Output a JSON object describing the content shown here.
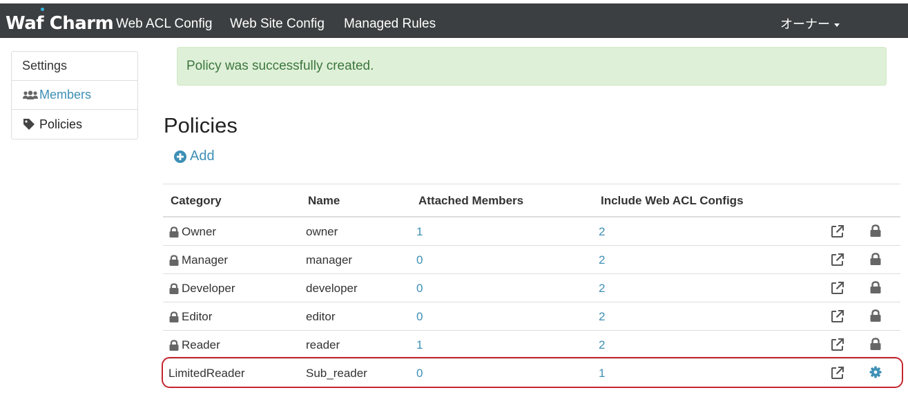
{
  "navbar": {
    "logo": "Waf Charm",
    "links": [
      "Web ACL Config",
      "Web Site Config",
      "Managed Rules"
    ],
    "user_menu": "オーナー"
  },
  "sidebar": {
    "heading": "Settings",
    "items": [
      {
        "label": "Members",
        "icon": "users-icon"
      },
      {
        "label": "Policies",
        "icon": "tag-icon"
      }
    ]
  },
  "alert": {
    "message": "Policy was successfully created."
  },
  "page": {
    "title": "Policies",
    "add_label": "Add"
  },
  "table": {
    "headers": [
      "Category",
      "Name",
      "Attached Members",
      "Include Web ACL Configs"
    ],
    "rows": [
      {
        "category": "Owner",
        "name": "owner",
        "members": "1",
        "configs": "2",
        "locked": true
      },
      {
        "category": "Manager",
        "name": "manager",
        "members": "0",
        "configs": "2",
        "locked": true
      },
      {
        "category": "Developer",
        "name": "developer",
        "members": "0",
        "configs": "2",
        "locked": true
      },
      {
        "category": "Editor",
        "name": "editor",
        "members": "0",
        "configs": "2",
        "locked": true
      },
      {
        "category": "Reader",
        "name": "reader",
        "members": "1",
        "configs": "2",
        "locked": true
      },
      {
        "category": "LimitedReader",
        "name": "Sub_reader",
        "members": "0",
        "configs": "1",
        "locked": false
      }
    ]
  },
  "colors": {
    "navbar_bg": "#3c3f41",
    "link": "#3d8fb5",
    "alert_bg": "#dff0d8",
    "alert_text": "#3c763d",
    "highlight": "#c4262e",
    "icon_gray": "#666666"
  }
}
